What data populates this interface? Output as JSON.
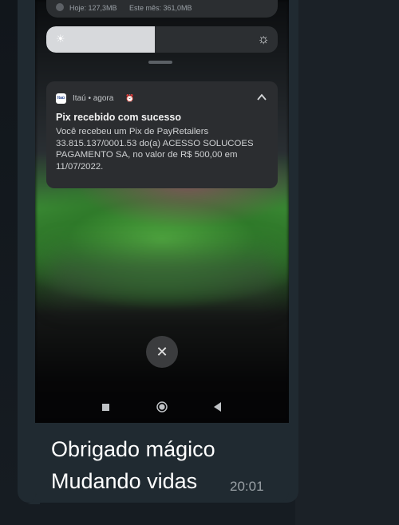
{
  "storage": {
    "today": "Hoje: 127,3MB",
    "month": "Este mês: 361,0MB"
  },
  "brightness": {
    "level_percent": 47,
    "icon_low": "sun-small-icon",
    "icon_high": "sun-large-icon"
  },
  "notification": {
    "app_name": "Itaú",
    "time": "agora",
    "app_icon_text": "Itaú",
    "title": "Pix recebido com sucesso",
    "body": "Você recebeu um Pix de PayRetailers 33.815.137/0001.53 do(a) ACESSO SOLUCOES PAGAMENTO SA, no valor de R$ 500,00 em 11/07/2022."
  },
  "caption": {
    "line1": "Obrigado mágico",
    "line2": "Mudando vidas",
    "time": "20:01"
  },
  "colors": {
    "chat_bubble": "#202a31",
    "notification_bg": "#2b2d30",
    "accent_green": "#3c8c35"
  }
}
